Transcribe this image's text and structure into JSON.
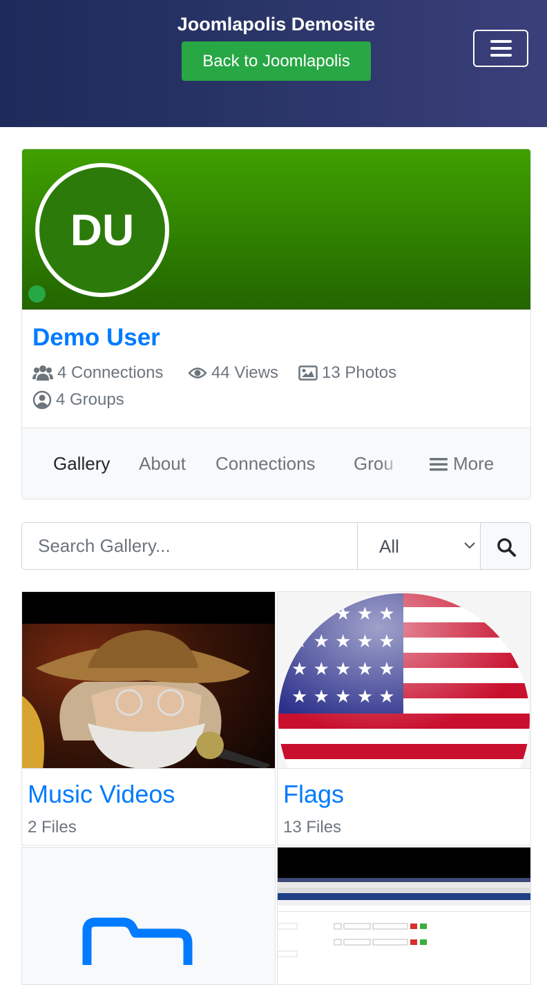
{
  "header": {
    "site_title": "Joomlapolis Demosite",
    "back_button": "Back to Joomlapolis",
    "brand_color": "#28a745"
  },
  "profile": {
    "initials": "DU",
    "name": "Demo User",
    "online": true,
    "stats": {
      "connections": "4 Connections",
      "views": "44 Views",
      "photos": "13 Photos",
      "groups": "4 Groups"
    }
  },
  "tabs": {
    "items": [
      "Gallery",
      "About",
      "Connections",
      "Grou"
    ],
    "more": "More",
    "active": "Gallery"
  },
  "search": {
    "placeholder": "Search Gallery...",
    "filter_value": "All"
  },
  "gallery": [
    {
      "title": "Music Videos",
      "count": "2 Files",
      "thumb": "musician-photo"
    },
    {
      "title": "Flags",
      "count": "13 Files",
      "thumb": "us-flag-sphere"
    },
    {
      "title": "",
      "count": "",
      "thumb": "folder-icon"
    },
    {
      "title": "",
      "count": "",
      "thumb": "screenshot"
    }
  ]
}
